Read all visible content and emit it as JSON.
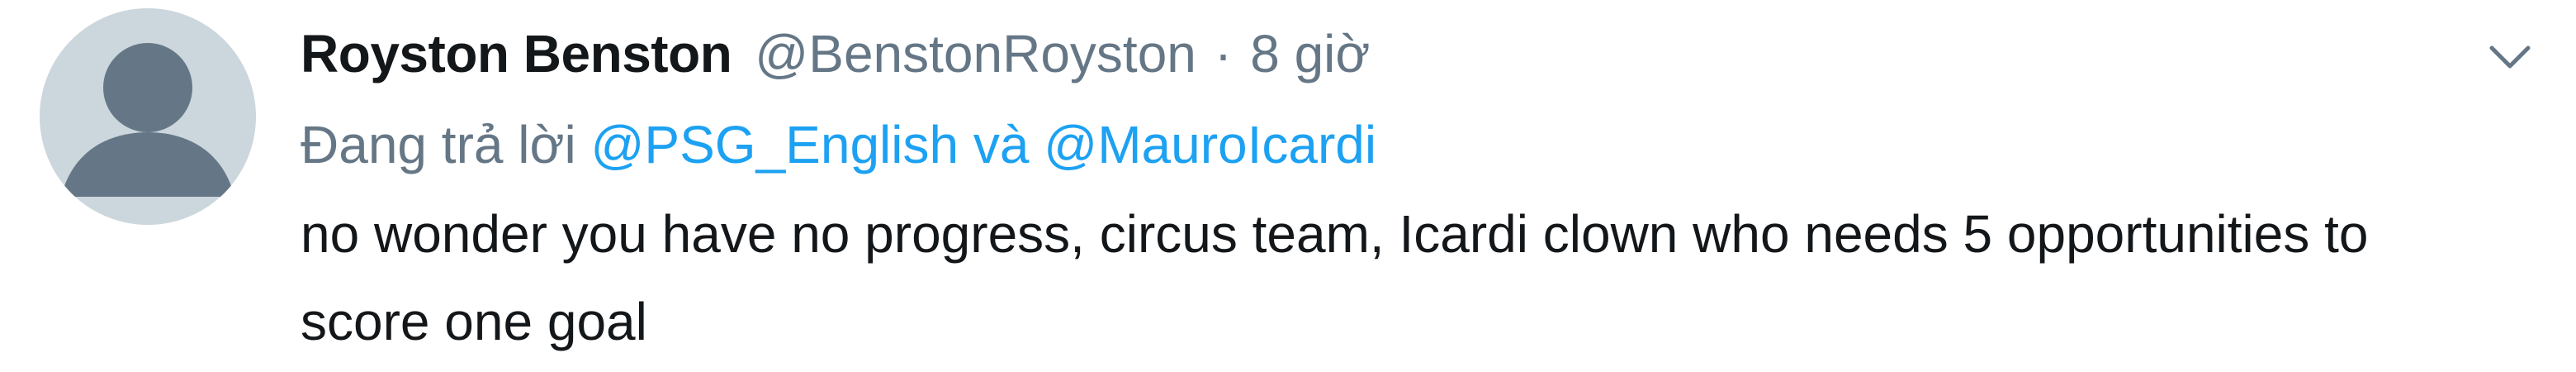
{
  "tweet": {
    "display_name": "Royston Benston",
    "handle": "@BenstonRoyston",
    "separator": "·",
    "timestamp": "8 giờ",
    "reply": {
      "prefix": "Đang trả lời",
      "mention_1": "@PSG_English",
      "conjunction": "và",
      "mention_2": "@MauroIcardi"
    },
    "text": "no wonder you have no progress, circus team, Icardi clown who needs 5 opportunities to score one goal"
  },
  "icons": {
    "avatar": "default-profile-icon",
    "menu": "chevron-down-icon"
  },
  "colors": {
    "avatar_bg": "#ccd6dd",
    "avatar_fg": "#657786",
    "mention": "#1da1f2",
    "secondary_text": "#657786",
    "primary_text": "#14171a"
  }
}
